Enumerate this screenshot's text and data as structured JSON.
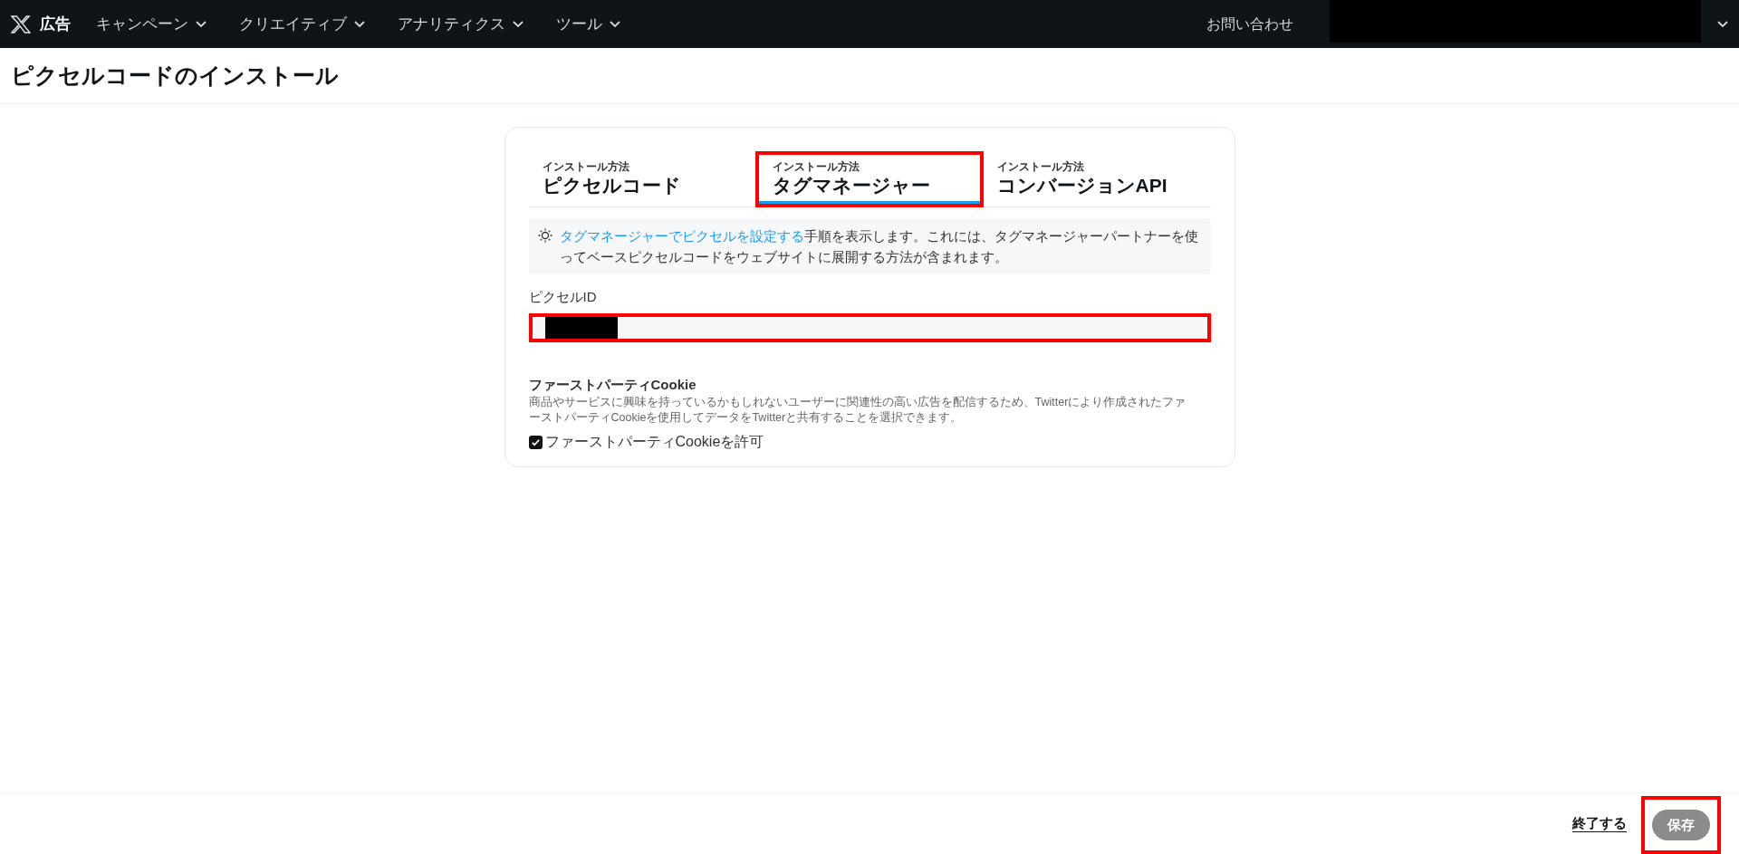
{
  "nav": {
    "brand": "広告",
    "menus": [
      {
        "label": "キャンペーン"
      },
      {
        "label": "クリエイティブ"
      },
      {
        "label": "アナリティクス"
      },
      {
        "label": "ツール"
      }
    ],
    "contact": "お問い合わせ"
  },
  "page_title": "ピクセルコードのインストール",
  "tabs": [
    {
      "caption": "インストール方法",
      "label": "ピクセルコード",
      "selected": false,
      "highlighted": false
    },
    {
      "caption": "インストール方法",
      "label": "タグマネージャー",
      "selected": true,
      "highlighted": true
    },
    {
      "caption": "インストール方法",
      "label": "コンバージョンAPI",
      "selected": false,
      "highlighted": false
    }
  ],
  "info": {
    "link": "タグマネージャーでピクセルを設定する",
    "text": "手順を表示します。これには、タグマネージャーパートナーを使ってベースピクセルコードをウェブサイトに展開する方法が含まれます。"
  },
  "pixel_id": {
    "label": "ピクセルID",
    "highlighted": true
  },
  "cookie": {
    "heading": "ファーストパーティCookie",
    "description": "商品やサービスに興味を持っているかもしれないユーザーに関連性の高い広告を配信するため、Twitterにより作成されたファーストパーティCookieを使用してデータをTwitterと共有することを選択できます。",
    "checkbox": {
      "label": "ファーストパーティCookieを許可",
      "checked": true
    }
  },
  "footer": {
    "exit_link": "終了する",
    "save_button": {
      "label": "保存",
      "disabled": true,
      "highlighted": true
    }
  }
}
